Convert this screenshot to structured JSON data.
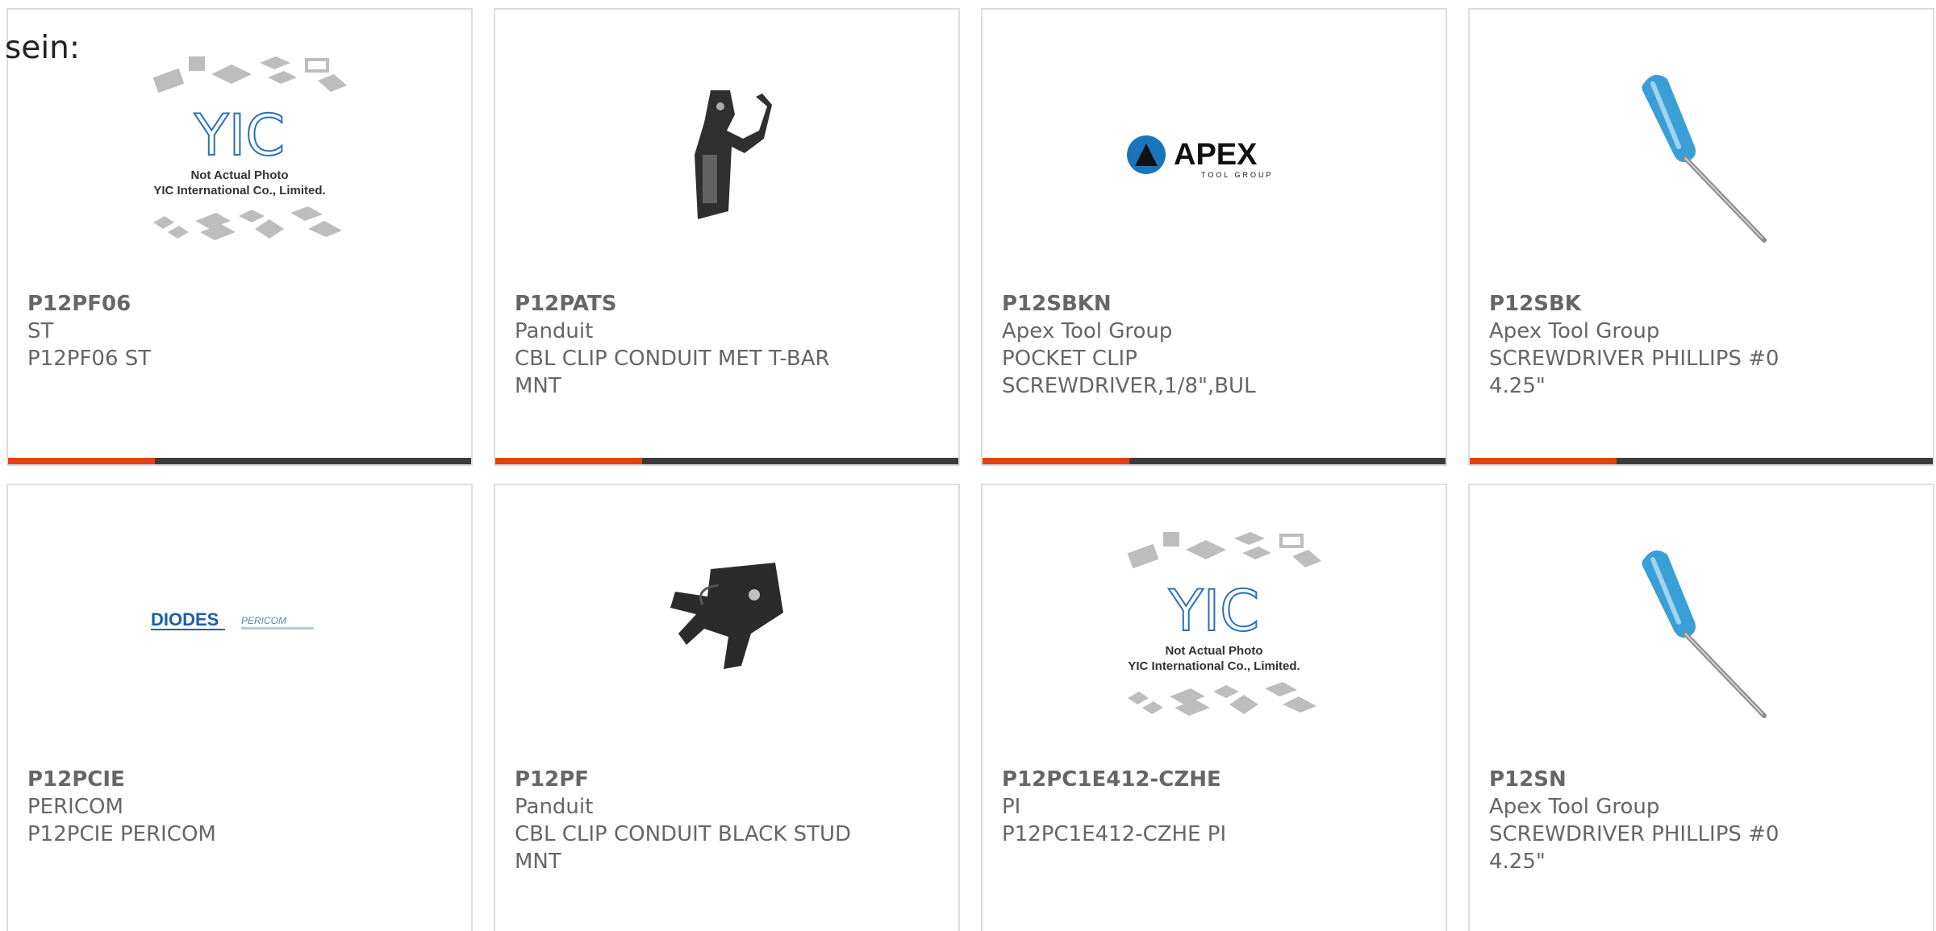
{
  "leading_text": "sein:",
  "colors": {
    "accent_bar": "#e64310",
    "dark_bar": "#3c3c3c",
    "card_border": "#dddddd",
    "text": "#666666",
    "apex_blue": "#1b75bb",
    "diodes_blue": "#1c5fa8"
  },
  "placeholder": {
    "line1": "Not Actual Photo",
    "line2": "YIC International Co., Limited.",
    "logo": "YIC"
  },
  "logos": {
    "apex": "APEX",
    "apex_sub": "TOOL GROUP",
    "diodes": "DIODES",
    "pericom": "PERICOM"
  },
  "products": [
    {
      "pn": "P12PF06",
      "mfr": "ST",
      "desc": "P12PF06 ST",
      "image": "yic-placeholder"
    },
    {
      "pn": "P12PATS",
      "mfr": "Panduit",
      "desc": "CBL CLIP CONDUIT MET T-BAR MNT",
      "image": "conduit-clip"
    },
    {
      "pn": "P12SBKN",
      "mfr": "Apex Tool Group",
      "desc": "POCKET CLIP SCREWDRIVER,1/8\",BUL",
      "image": "apex-logo"
    },
    {
      "pn": "P12SBK",
      "mfr": "Apex Tool Group",
      "desc": "SCREWDRIVER PHILLIPS #0 4.25\"",
      "image": "screwdriver"
    },
    {
      "pn": "P12PCIE",
      "mfr": "PERICOM",
      "desc": "P12PCIE PERICOM",
      "image": "diodes-logo"
    },
    {
      "pn": "P12PF",
      "mfr": "Panduit",
      "desc": "CBL CLIP CONDUIT BLACK STUD MNT",
      "image": "stud-clip"
    },
    {
      "pn": "P12PC1E412-CZHE",
      "mfr": "PI",
      "desc": "P12PC1E412-CZHE PI",
      "image": "yic-placeholder"
    },
    {
      "pn": "P12SN",
      "mfr": "Apex Tool Group",
      "desc": "SCREWDRIVER PHILLIPS #0 4.25\"",
      "image": "screwdriver"
    }
  ]
}
